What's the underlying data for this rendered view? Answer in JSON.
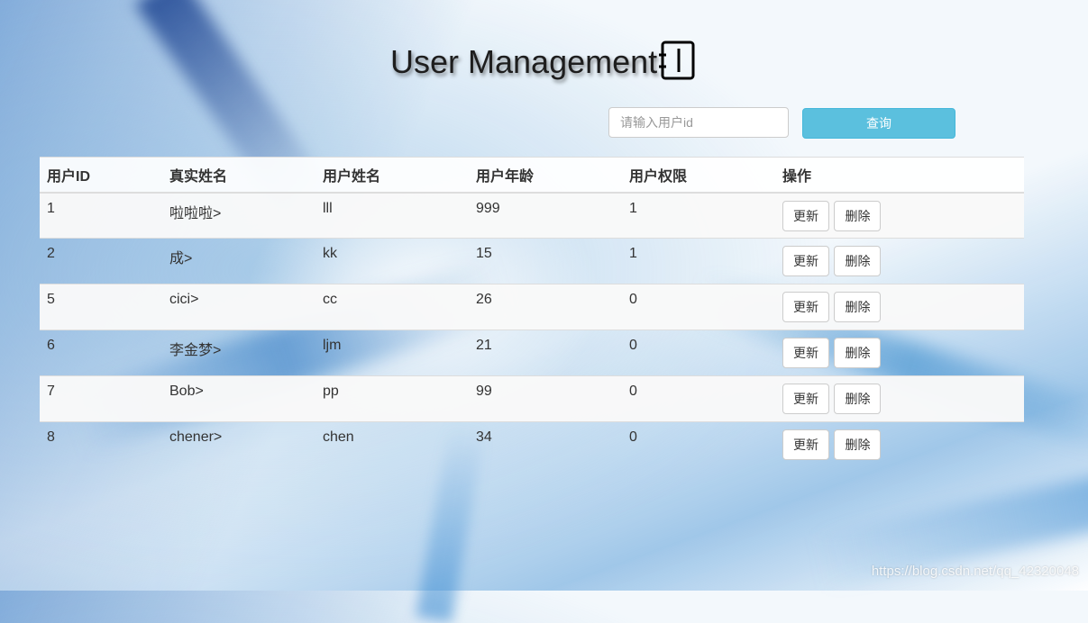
{
  "header": {
    "title": "User Management",
    "title_icon": "notebook-icon"
  },
  "search": {
    "placeholder": "请输入用户id",
    "value": "",
    "button_label": "查询"
  },
  "table": {
    "columns": [
      "用户ID",
      "真实姓名",
      "用户姓名",
      "用户年龄",
      "用户权限",
      "操作"
    ],
    "rows": [
      {
        "id": "1",
        "real_name": "啦啦啦>",
        "username": "lll",
        "age": "999",
        "permission": "1",
        "update": "更新",
        "delete": "删除"
      },
      {
        "id": "2",
        "real_name": "成>",
        "username": "kk",
        "age": "15",
        "permission": "1",
        "update": "更新",
        "delete": "删除"
      },
      {
        "id": "5",
        "real_name": "cici>",
        "username": "cc",
        "age": "26",
        "permission": "0",
        "update": "更新",
        "delete": "删除"
      },
      {
        "id": "6",
        "real_name": "李金梦>",
        "username": "ljm",
        "age": "21",
        "permission": "0",
        "update": "更新",
        "delete": "删除"
      },
      {
        "id": "7",
        "real_name": "Bob>",
        "username": "pp",
        "age": "99",
        "permission": "0",
        "update": "更新",
        "delete": "删除"
      },
      {
        "id": "8",
        "real_name": "chener>",
        "username": "chen",
        "age": "34",
        "permission": "0",
        "update": "更新",
        "delete": "删除"
      }
    ]
  },
  "watermark": "https://blog.csdn.net/qq_42320048",
  "colors": {
    "search_button": "#5bc0de",
    "row_stripe": "#f9f9f9",
    "border": "#dddddd"
  }
}
